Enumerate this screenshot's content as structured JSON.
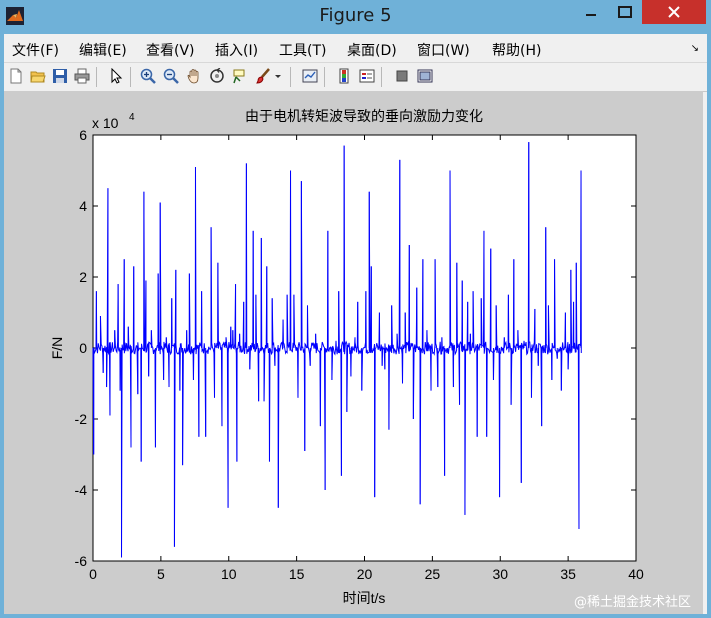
{
  "window": {
    "title": "Figure 5"
  },
  "menu": [
    "文件(F)",
    "编辑(E)",
    "查看(V)",
    "插入(I)",
    "工具(T)",
    "桌面(D)",
    "窗口(W)",
    "帮助(H)"
  ],
  "toolbar": [
    "new-file-icon",
    "open-folder-icon",
    "save-icon",
    "print-icon",
    "pointer-icon",
    "zoom-in-icon",
    "zoom-out-icon",
    "pan-hand-icon",
    "rotate-3d-icon",
    "data-cursor-icon",
    "brush-icon",
    "link-plot-icon",
    "colorbar-icon",
    "legend-icon",
    "hide-plot-tools-icon",
    "show-plot-tools-icon"
  ],
  "chart_data": {
    "type": "line",
    "title": "由于电机转矩波导致的垂向激励力变化",
    "xlabel": "时间t/s",
    "ylabel": "F/N",
    "exponent_label": "x 10",
    "exponent_power": "4",
    "xlim": [
      0,
      40
    ],
    "ylim": [
      -6,
      6
    ],
    "y_scale_factor": 10000,
    "xticks": [
      0,
      5,
      10,
      15,
      20,
      25,
      30,
      35,
      40
    ],
    "yticks": [
      -6,
      -4,
      -2,
      0,
      2,
      4,
      6
    ],
    "series_color": "#0000ff",
    "x_end": 36,
    "spikes": [
      [
        0.05,
        -3.0
      ],
      [
        0.25,
        1.6
      ],
      [
        0.55,
        0.9
      ],
      [
        0.75,
        -0.7
      ],
      [
        1.0,
        -1.1
      ],
      [
        1.1,
        4.5
      ],
      [
        1.25,
        -1.9
      ],
      [
        1.6,
        0.5
      ],
      [
        1.85,
        1.8
      ],
      [
        2.0,
        -1.2
      ],
      [
        2.1,
        -5.9
      ],
      [
        2.3,
        2.5
      ],
      [
        2.6,
        0.6
      ],
      [
        2.8,
        -2.8
      ],
      [
        3.0,
        2.3
      ],
      [
        3.3,
        -1.3
      ],
      [
        3.55,
        -3.2
      ],
      [
        3.75,
        4.4
      ],
      [
        3.9,
        1.9
      ],
      [
        4.1,
        -0.8
      ],
      [
        4.3,
        0.5
      ],
      [
        4.6,
        -2.8
      ],
      [
        4.8,
        2.1
      ],
      [
        4.95,
        4.1
      ],
      [
        5.2,
        -0.9
      ],
      [
        5.4,
        0.3
      ],
      [
        5.6,
        -1.1
      ],
      [
        5.8,
        1.4
      ],
      [
        6.0,
        -5.6
      ],
      [
        6.1,
        2.2
      ],
      [
        6.4,
        -1.2
      ],
      [
        6.6,
        -3.3
      ],
      [
        6.9,
        0.5
      ],
      [
        7.1,
        2.1
      ],
      [
        7.4,
        -0.9
      ],
      [
        7.55,
        5.1
      ],
      [
        7.8,
        -2.5
      ],
      [
        8.0,
        1.6
      ],
      [
        8.3,
        -2.5
      ],
      [
        8.7,
        3.4
      ],
      [
        8.95,
        -1.4
      ],
      [
        9.2,
        2.4
      ],
      [
        9.5,
        -2.2
      ],
      [
        9.8,
        0.3
      ],
      [
        9.95,
        -4.5
      ],
      [
        10.15,
        0.6
      ],
      [
        10.3,
        0.5
      ],
      [
        10.5,
        1.8
      ],
      [
        10.6,
        -3.2
      ],
      [
        10.8,
        0.4
      ],
      [
        11.1,
        1.3
      ],
      [
        11.3,
        5.2
      ],
      [
        11.55,
        -0.6
      ],
      [
        11.8,
        3.3
      ],
      [
        12.0,
        1.5
      ],
      [
        12.2,
        -1.5
      ],
      [
        12.4,
        3.1
      ],
      [
        12.6,
        -1.5
      ],
      [
        12.8,
        2.3
      ],
      [
        13.0,
        -3.2
      ],
      [
        13.2,
        1.4
      ],
      [
        13.4,
        -0.5
      ],
      [
        13.65,
        -4.5
      ],
      [
        14.0,
        0.8
      ],
      [
        14.3,
        1.5
      ],
      [
        14.55,
        5.0
      ],
      [
        14.8,
        1.5
      ],
      [
        15.1,
        -1.4
      ],
      [
        15.35,
        4.7
      ],
      [
        15.6,
        -2.9
      ],
      [
        15.8,
        1.2
      ],
      [
        16.0,
        -0.5
      ],
      [
        16.4,
        0.4
      ],
      [
        16.75,
        -2.2
      ],
      [
        17.1,
        -4.0
      ],
      [
        17.3,
        3.3
      ],
      [
        17.6,
        -0.9
      ],
      [
        17.9,
        0.2
      ],
      [
        18.1,
        1.6
      ],
      [
        18.3,
        -3.6
      ],
      [
        18.5,
        5.7
      ],
      [
        18.7,
        -1.8
      ],
      [
        19.0,
        -0.8
      ],
      [
        19.3,
        0.3
      ],
      [
        19.5,
        1.3
      ],
      [
        19.8,
        -1.2
      ],
      [
        20.1,
        1.6
      ],
      [
        20.35,
        4.4
      ],
      [
        20.5,
        2.3
      ],
      [
        20.75,
        -4.2
      ],
      [
        21.1,
        1.0
      ],
      [
        21.3,
        -0.5
      ],
      [
        21.5,
        -0.6
      ],
      [
        21.8,
        -2.3
      ],
      [
        22.0,
        1.2
      ],
      [
        22.4,
        0.4
      ],
      [
        22.6,
        5.3
      ],
      [
        22.8,
        -1.0
      ],
      [
        23.0,
        1.0
      ],
      [
        23.3,
        2.9
      ],
      [
        23.6,
        -2.0
      ],
      [
        23.85,
        1.7
      ],
      [
        24.1,
        -4.4
      ],
      [
        24.3,
        2.5
      ],
      [
        24.6,
        0.5
      ],
      [
        24.9,
        -1.2
      ],
      [
        25.2,
        2.5
      ],
      [
        25.4,
        -1.1
      ],
      [
        25.7,
        0.3
      ],
      [
        25.9,
        -3.6
      ],
      [
        26.3,
        5.0
      ],
      [
        26.55,
        -1.1
      ],
      [
        26.8,
        2.4
      ],
      [
        27.0,
        -1.6
      ],
      [
        27.2,
        1.9
      ],
      [
        27.4,
        -4.7
      ],
      [
        27.6,
        1.3
      ],
      [
        27.8,
        0.4
      ],
      [
        28.0,
        1.6
      ],
      [
        28.3,
        -2.5
      ],
      [
        28.6,
        1.4
      ],
      [
        28.8,
        3.3
      ],
      [
        29.0,
        -2.5
      ],
      [
        29.3,
        2.8
      ],
      [
        29.5,
        -0.9
      ],
      [
        29.7,
        1.2
      ],
      [
        29.95,
        -4.2
      ],
      [
        30.3,
        0.3
      ],
      [
        30.6,
        1.5
      ],
      [
        30.8,
        -1.6
      ],
      [
        31.0,
        2.5
      ],
      [
        31.3,
        0.5
      ],
      [
        31.55,
        -3.8
      ],
      [
        31.75,
        0.2
      ],
      [
        32.1,
        5.8
      ],
      [
        32.3,
        -1.4
      ],
      [
        32.55,
        1.1
      ],
      [
        32.8,
        -0.5
      ],
      [
        33.05,
        -2.2
      ],
      [
        33.35,
        3.4
      ],
      [
        33.55,
        1.2
      ],
      [
        33.8,
        -0.9
      ],
      [
        34.0,
        2.5
      ],
      [
        34.2,
        -0.3
      ],
      [
        34.5,
        -1.2
      ],
      [
        34.8,
        1.0
      ],
      [
        35.0,
        -0.6
      ],
      [
        35.2,
        2.2
      ],
      [
        35.4,
        1.3
      ],
      [
        35.6,
        2.4
      ],
      [
        35.8,
        -5.1
      ],
      [
        35.95,
        5.0
      ]
    ]
  },
  "watermark": "@稀土掘金技术社区"
}
